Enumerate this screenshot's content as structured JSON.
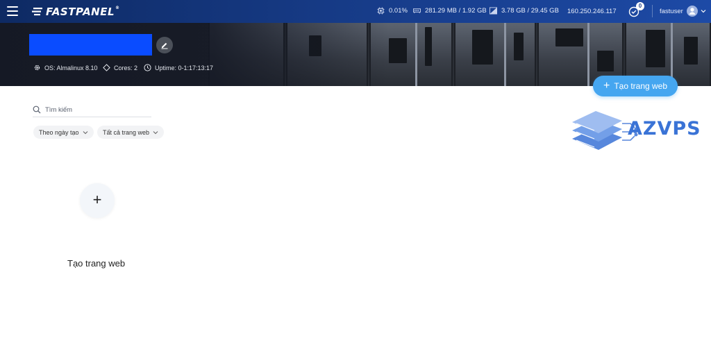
{
  "brand": {
    "name": "FASTPANEL",
    "reg": "®"
  },
  "stats": {
    "cpu": "0.01%",
    "ram": "281.29 MB / 1.92 GB",
    "disk": "3.78 GB / 29.45 GB",
    "ip": "160.250.246.117"
  },
  "notifications": {
    "count": "0"
  },
  "user": {
    "name": "fastuser"
  },
  "server": {
    "os": "OS: Almalinux 8.10",
    "cores": "Cores: 2",
    "uptime": "Uptime: 0-1:17:13:17"
  },
  "actions": {
    "create_site": "Tạo trang web"
  },
  "search": {
    "placeholder": "Tìm kiếm"
  },
  "filters": [
    {
      "label": "Theo ngày tạo"
    },
    {
      "label": "Tất cả trang web"
    }
  ],
  "empty_state": {
    "add_label": "Tạo trang web"
  },
  "watermark": {
    "text": "AZVPS"
  },
  "colors": {
    "topbar": "#163a85",
    "accent": "#45a6f0",
    "redacted_name": "#0a4cff"
  }
}
